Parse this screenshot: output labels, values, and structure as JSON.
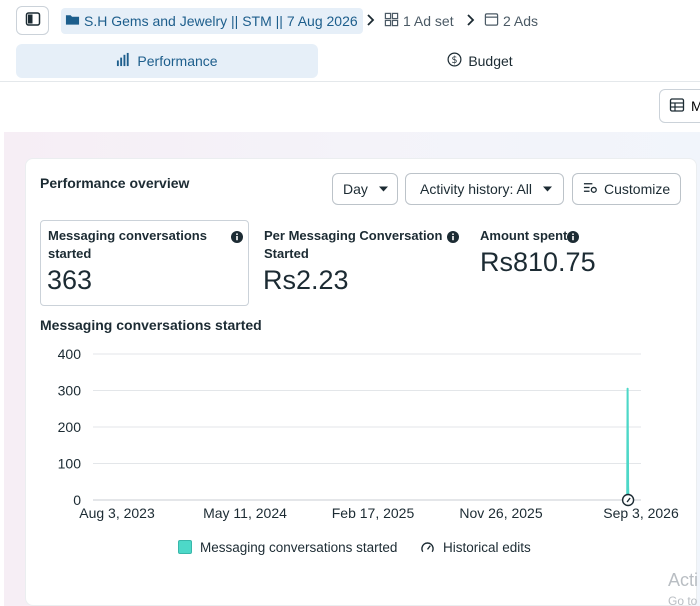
{
  "breadcrumb": {
    "campaign": "S.H Gems and Jewelry || STM || 7 Aug 2026",
    "adset": "1 Ad set",
    "ads": "2 Ads"
  },
  "tabs": [
    {
      "label": "Performance",
      "active": true,
      "icon": "bar-chart-icon"
    },
    {
      "label": "Budget",
      "active": false,
      "icon": "dollar-circle-icon"
    }
  ],
  "toolbar": {
    "table_button_label": "M"
  },
  "overview": {
    "title": "Performance overview",
    "day_label": "Day",
    "activity_label": "Activity history: All",
    "customize_label": "Customize"
  },
  "metrics": [
    {
      "label_line1": "Messaging conversations",
      "label_line2": "started",
      "value": "363"
    },
    {
      "label_line1": "Per Messaging Conversation",
      "label_line2": "Started",
      "value": "Rs2.23"
    },
    {
      "label_line1": "Amount spent",
      "label_line2": "",
      "value": "Rs810.75"
    }
  ],
  "chart_data": {
    "type": "line",
    "title": "Messaging conversations started",
    "yticks": [
      0,
      100,
      200,
      300,
      400
    ],
    "ylim": [
      0,
      400
    ],
    "x_tick_labels": [
      "Aug 3, 2023",
      "May 11, 2024",
      "Feb 17, 2025",
      "Nov 26, 2025",
      "Sep 3, 2026"
    ],
    "xlim": [
      "2023-08-03",
      "2026-09-03"
    ],
    "series": [
      {
        "name": "Messaging conversations started",
        "color": "#4dd8c8",
        "points": [
          {
            "x": "2026-08-30",
            "y": 0
          },
          {
            "x": "2026-08-31",
            "y": 305
          },
          {
            "x": "2026-09-01",
            "y": 40
          },
          {
            "x": "2026-09-02",
            "y": 0
          }
        ]
      }
    ],
    "historical_edit_marker": {
      "x": "2026-09-01"
    },
    "grid": true,
    "legend": {
      "position": "bottom",
      "items": [
        "Messaging conversations started",
        "Historical edits"
      ]
    }
  },
  "watermark": {
    "line1": "Acti",
    "line2": "Go to"
  }
}
